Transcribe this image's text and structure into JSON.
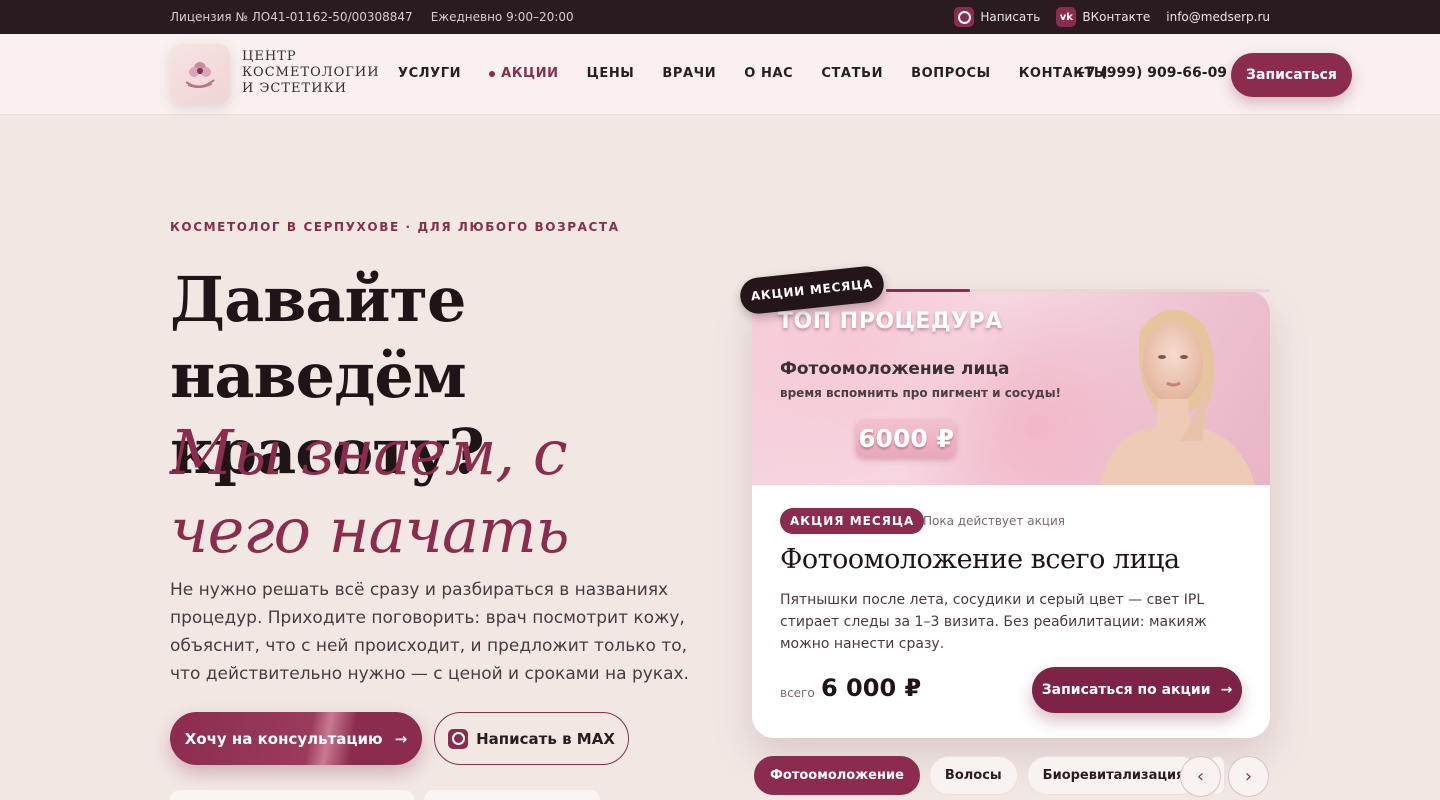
{
  "topbar": {
    "license": "Лицензия № ЛО41-01162-50/00308847",
    "hours": "Ежедневно 9:00–20:00",
    "write": "Написать",
    "vk": "ВКонтакте",
    "email": "info@medserp.ru"
  },
  "header": {
    "logo_text": "ЦЕНТР КОСМЕТОЛОГИИ И ЭСТЕТИКИ",
    "nav": [
      "УСЛУГИ",
      "АКЦИИ",
      "ЦЕНЫ",
      "ВРАЧИ",
      "О НАС",
      "СТАТЬИ",
      "ВОПРОСЫ",
      "КОНТАКТЫ"
    ],
    "phone": "+7 (999) 909-66-09",
    "book": "Записаться"
  },
  "hero": {
    "eyebrow": "КОСМЕТОЛОГ В СЕРПУХОВЕ · ДЛЯ ЛЮБОГО ВОЗРАСТА",
    "title": "Давайте наведём красоту?",
    "title_accent": "Мы знаем, с чего начать",
    "lead": "Не нужно решать всё сразу и разбираться в названиях процедур. Приходите поговорить: врач посмотрит кожу, объяснит, что с ней происходит, и предложит только то, что действительно нужно — с ценой и сроками на руках.",
    "cta_primary": "Хочу на консультацию",
    "cta_secondary": "Написать в MAX"
  },
  "promo": {
    "badge": "АКЦИИ МЕСЯЦА",
    "banner": {
      "top": "ТОП ПРОЦЕДУРА",
      "title": "Фотоомоложение лица",
      "subtitle": "время вспомнить про пигмент и сосуды!",
      "price": "6000 ₽"
    },
    "pill": "АКЦИЯ МЕСЯЦА",
    "pill_note": "Пока действует акция",
    "title": "Фотоомоложение всего лица",
    "description": "Пятнышки после лета, сосудики и серый цвет — свет IPL стирает следы за 1–3 визита. Без реабилитации: макияж можно нанести сразу.",
    "price_label": "всего",
    "price": "6 000 ₽",
    "cta": "Записаться по акции",
    "progress": 0.22
  },
  "chips": [
    "Фотоомоложение",
    "Волосы",
    "Биоревитализация"
  ],
  "colors": {
    "accent": "#8b2c4e",
    "dark": "#2a1b20",
    "background": "#f1e8e4"
  }
}
